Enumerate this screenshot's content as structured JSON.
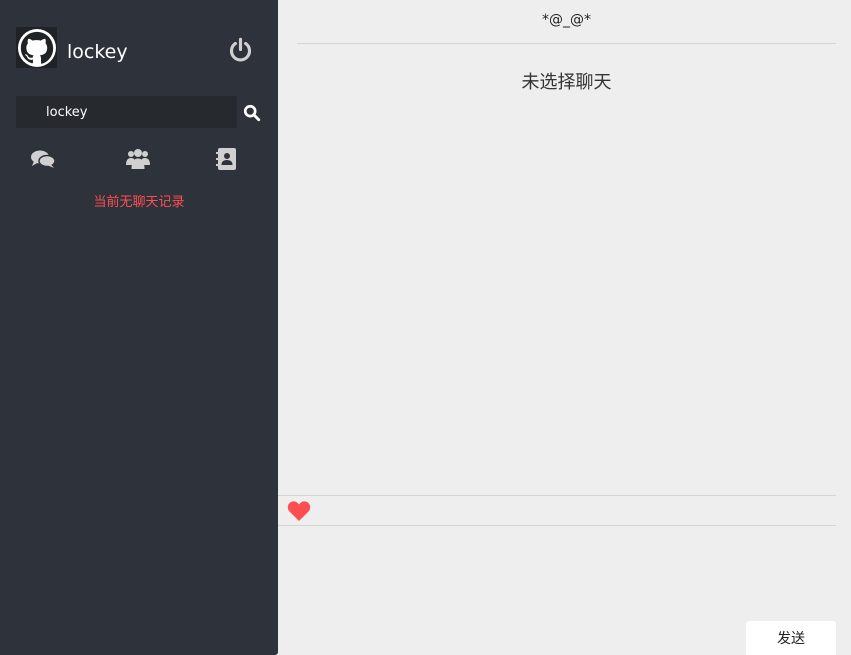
{
  "user": {
    "name": "lockey"
  },
  "search": {
    "value": "lockey"
  },
  "sidebar": {
    "tabs": [
      {
        "icon": "chat-bubbles-icon"
      },
      {
        "icon": "users-group-icon"
      },
      {
        "icon": "address-book-icon"
      }
    ],
    "empty_message": "当前无聊天记录"
  },
  "chat": {
    "title": "*@_@*",
    "no_chat_selected": "未选择聊天"
  },
  "composer": {
    "emoji_icon": "heart-icon",
    "send_label": "发送"
  },
  "colors": {
    "sidebar_bg": "#2e323a",
    "main_bg": "#eeeeee",
    "accent_red": "#ff4e52",
    "icon_gray": "#d0d0d0"
  }
}
